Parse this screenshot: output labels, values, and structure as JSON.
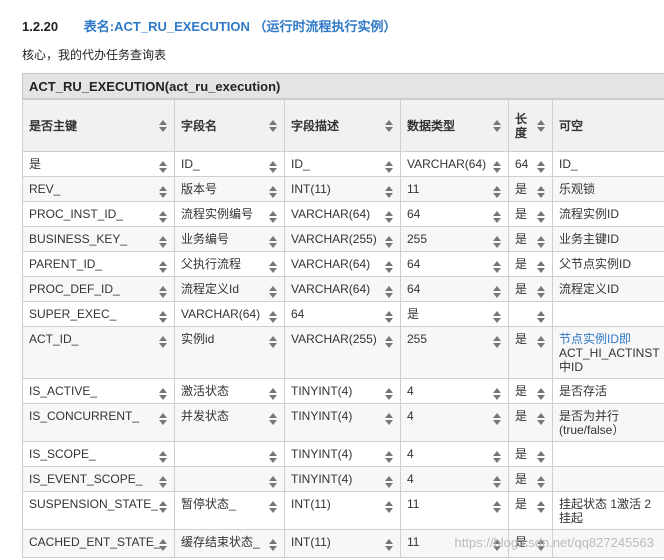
{
  "section": {
    "number": "1.2.20",
    "title_prefix": "表名:",
    "table_name": "ACT_RU_EXECUTION",
    "subtitle": "（运行时流程执行实例）",
    "description": "核心，我的代办任务查询表"
  },
  "table": {
    "caption": "ACT_RU_EXECUTION(act_ru_execution)",
    "headers": [
      "是否主键",
      "字段名",
      "字段描述",
      "数据类型",
      "长度",
      "可空"
    ],
    "rows": [
      [
        "是",
        "ID_",
        "ID_",
        "VARCHAR(64)",
        "64",
        "ID_"
      ],
      [
        "REV_",
        "版本号",
        "INT(11)",
        "11",
        "是",
        "乐观锁"
      ],
      [
        "PROC_INST_ID_",
        "流程实例编号",
        "VARCHAR(64)",
        "64",
        "是",
        "流程实例ID"
      ],
      [
        "BUSINESS_KEY_",
        "业务编号",
        "VARCHAR(255)",
        "255",
        "是",
        "业务主键ID"
      ],
      [
        "PARENT_ID_",
        "父执行流程",
        "VARCHAR(64)",
        "64",
        "是",
        "父节点实例ID"
      ],
      [
        "PROC_DEF_ID_",
        "流程定义Id",
        "VARCHAR(64)",
        "64",
        "是",
        "流程定义ID"
      ],
      [
        "SUPER_EXEC_",
        "VARCHAR(64)",
        "64",
        "是",
        "",
        ""
      ],
      [
        "ACT_ID_",
        "实例id",
        "VARCHAR(255)",
        "255",
        "是",
        "节点实例ID即 ACT_HI_ACTINST中ID"
      ],
      [
        "IS_ACTIVE_",
        "激活状态",
        "TINYINT(4)",
        "4",
        "是",
        "是否存活"
      ],
      [
        "IS_CONCURRENT_",
        "并发状态",
        "TINYINT(4)",
        "4",
        "是",
        "是否为并行(true/false）"
      ],
      [
        "IS_SCOPE_",
        "",
        "TINYINT(4)",
        "4",
        "是",
        ""
      ],
      [
        "IS_EVENT_SCOPE_",
        "",
        "TINYINT(4)",
        "4",
        "是",
        ""
      ],
      [
        "SUSPENSION_STATE_",
        "暂停状态_",
        "INT(11)",
        "11",
        "是",
        "挂起状态   1激活 2挂起"
      ],
      [
        "CACHED_ENT_STATE_",
        "缓存结束状态_",
        "INT(11)",
        "11",
        "是",
        ""
      ]
    ]
  },
  "watermark": "https://blog.csdn.net/qq827245563"
}
